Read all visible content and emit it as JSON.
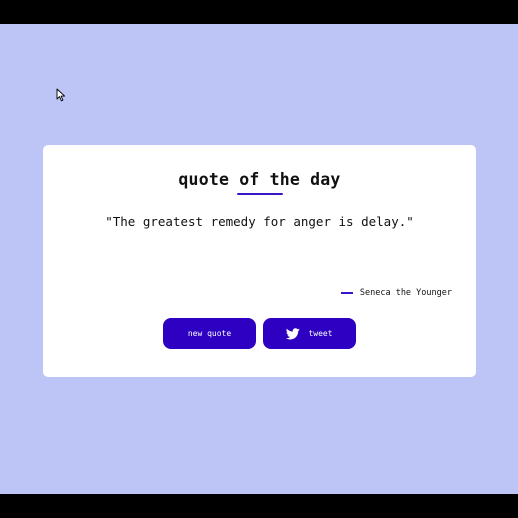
{
  "card": {
    "title": "quote of the day",
    "quote": "\"The greatest remedy for anger is delay.\"",
    "author": "Seneca the Younger"
  },
  "buttons": {
    "new_quote_label": "new quote",
    "tweet_label": "tweet",
    "tweet_icon": "twitter-icon"
  },
  "colors": {
    "background": "#bcc5f5",
    "card": "#ffffff",
    "accent": "#2d00c2"
  }
}
